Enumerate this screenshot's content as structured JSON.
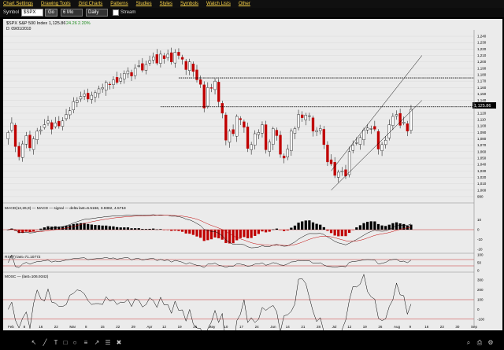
{
  "menu": [
    "Chart Settings",
    "Drawing Tools",
    "Grid Charts",
    "Patterns",
    "Studies",
    "Styles",
    "Symbols",
    "Watch Lists",
    "Other"
  ],
  "toolbar": {
    "symbol_label": "Symbol",
    "symbol_value": "$SPX",
    "go_label": "Go",
    "period_value": "6 Mo",
    "daily_value": "Daily",
    "streams_label": "Stream"
  },
  "header": {
    "symbol": "$SPX S&P 500 Index",
    "last": "1,125.86",
    "change": "24.26",
    "change_pct": "2.20%",
    "date_line": "D: 09/01/2010",
    "last_tag": "1,125.86"
  },
  "price_axis": [
    "1,240",
    "1,230",
    "1,220",
    "1,210",
    "1,200",
    "1,190",
    "1,180",
    "1,170",
    "1,160",
    "1,150",
    "1,140",
    "1,130",
    "1,120",
    "1,110",
    "1,100",
    "1,090",
    "1,080",
    "1,070",
    "1,060",
    "1,050",
    "1,040",
    "1,030",
    "1,020",
    "1,010",
    "1,000",
    "990"
  ],
  "macd_label": "MACD(12,26,9) — MACD — signal — delta  last=6.5166, 3.9382, 4.5718",
  "macd_axis": [
    "10",
    "0",
    "-10",
    "-20"
  ],
  "rsi_label": "RSI(7)  last=71.10772",
  "rsi_axis": [
    "100",
    "50",
    "0"
  ],
  "mosc_label": "MOSC — (last=106.9342)",
  "mosc_axis": [
    "300",
    "200",
    "100",
    "0",
    "-100"
  ],
  "date_axis": [
    "Feb",
    "8",
    "16",
    "22",
    "Mar",
    "8",
    "15",
    "22",
    "29",
    "Apr",
    "12",
    "19",
    "26",
    "May",
    "10",
    "17",
    "24",
    "Jun",
    "14",
    "21",
    "28",
    "Jul",
    "12",
    "19",
    "26",
    "Aug",
    "9",
    "16",
    "23",
    "30",
    "Sep"
  ],
  "price_data": {
    "start_date": "2010-02-01",
    "closes": [
      1090,
      1105,
      1068,
      1052,
      1072,
      1085,
      1066,
      1080,
      1092,
      1094,
      1102,
      1108,
      1095,
      1105,
      1100,
      1108,
      1118,
      1124,
      1138,
      1140,
      1146,
      1150,
      1142,
      1148,
      1152,
      1158,
      1160,
      1168,
      1165,
      1172,
      1168,
      1175,
      1182,
      1186,
      1178,
      1190,
      1194,
      1187,
      1196,
      1202,
      1208,
      1198,
      1212,
      1205,
      1212,
      1200,
      1215,
      1210,
      1204,
      1188,
      1200,
      1185,
      1172,
      1165,
      1128,
      1160,
      1159,
      1170,
      1138,
      1120,
      1078,
      1092,
      1088,
      1115,
      1110,
      1098,
      1065,
      1071,
      1088,
      1090,
      1102,
      1063,
      1075,
      1096,
      1085,
      1056,
      1050,
      1064,
      1092,
      1096,
      1118,
      1113,
      1117,
      1116,
      1092,
      1093,
      1096,
      1071,
      1044,
      1041,
      1023,
      1028,
      1030,
      1022,
      1060,
      1070,
      1074,
      1082,
      1094,
      1097,
      1096,
      1095,
      1064,
      1071,
      1078,
      1102,
      1115,
      1118,
      1101,
      1106,
      1092,
      1126
    ],
    "price_min": 985,
    "price_max": 1245,
    "resistance": [
      1175,
      1130
    ]
  },
  "colors": {
    "up": "#ffffff",
    "down": "#c00000",
    "line": "#000000",
    "grid": "#c8c8c8"
  }
}
